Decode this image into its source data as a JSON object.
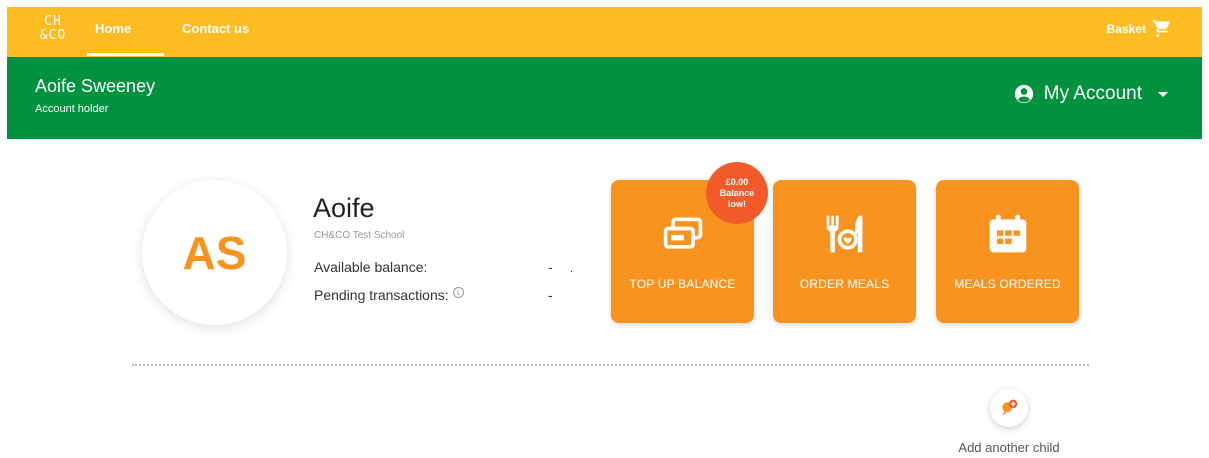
{
  "nav": {
    "logo_top": "CH",
    "logo_bottom": "&CO",
    "home_label": "Home",
    "contact_label": "Contact us",
    "basket_label": "Basket"
  },
  "account": {
    "name": "Aoife Sweeney",
    "role": "Account holder",
    "menu_label": "My Account"
  },
  "child": {
    "initials": "AS",
    "name": "Aoife",
    "school": "CH&CO Test School",
    "balance_label": "Available balance:",
    "balance_value": "-",
    "balance_extra": ".",
    "pending_label": "Pending transactions:",
    "pending_value": "-"
  },
  "tiles": {
    "topup_label": "TOP UP BALANCE",
    "order_label": "ORDER MEALS",
    "ordered_label": "MEALS ORDERED"
  },
  "badge": {
    "amount": "£0.00",
    "line1": "Balance",
    "line2": "low!"
  },
  "add_child_label": "Add another child",
  "colors": {
    "topbar": "#fdbd22",
    "accountbar": "#00923f",
    "tile": "#f7931e",
    "badge": "#f25a2b"
  }
}
